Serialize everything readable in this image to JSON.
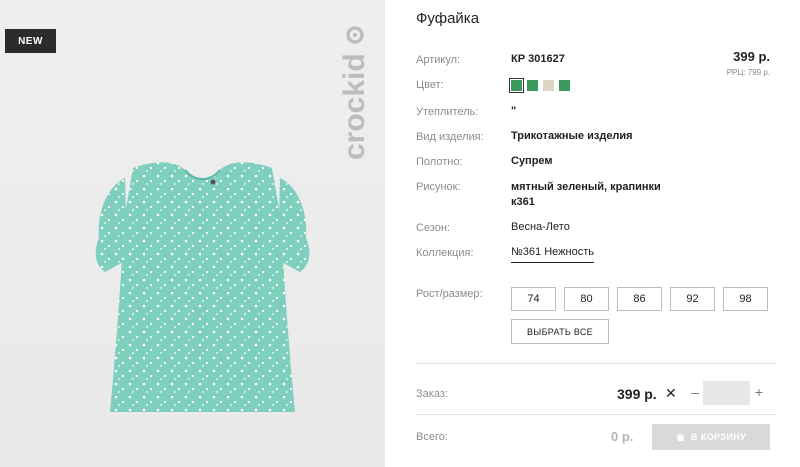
{
  "product": {
    "badge": "NEW",
    "brand": "crockid",
    "title": "Фуфайка",
    "price": "399 р.",
    "rrp": "РРЦ: 799 р."
  },
  "attributes": {
    "article_label": "Артикул:",
    "article_value": "КР 301627",
    "color_label": "Цвет:",
    "color_swatches": [
      "#3d9a5e",
      "#3d9a5e",
      "#ddd7c2",
      "#3d9a5e"
    ],
    "insulation_label": "Утеплитель:",
    "insulation_value": "\"",
    "type_label": "Вид изделия:",
    "type_value": "Трикотажные изделия",
    "fabric_label": "Полотно:",
    "fabric_value": "Супрем",
    "pattern_label": "Рисунок:",
    "pattern_value_line1": "мятный зеленый, крапинки",
    "pattern_value_line2": "к361",
    "season_label": "Сезон:",
    "season_value": "Весна-Лето",
    "collection_label": "Коллекция:",
    "collection_value": "№361 Нежность"
  },
  "sizes": {
    "label": "Рост/размер:",
    "options": [
      "74",
      "80",
      "86",
      "92",
      "98"
    ],
    "select_all": "ВЫБРАТЬ ВСЕ"
  },
  "order": {
    "label": "Заказ:",
    "price": "399 р.",
    "multiply": "✕",
    "minus": "–",
    "plus": "+",
    "quantity": ""
  },
  "total": {
    "label": "Всего:",
    "value": "0 р.",
    "cart_button": "В КОРЗИНУ"
  }
}
